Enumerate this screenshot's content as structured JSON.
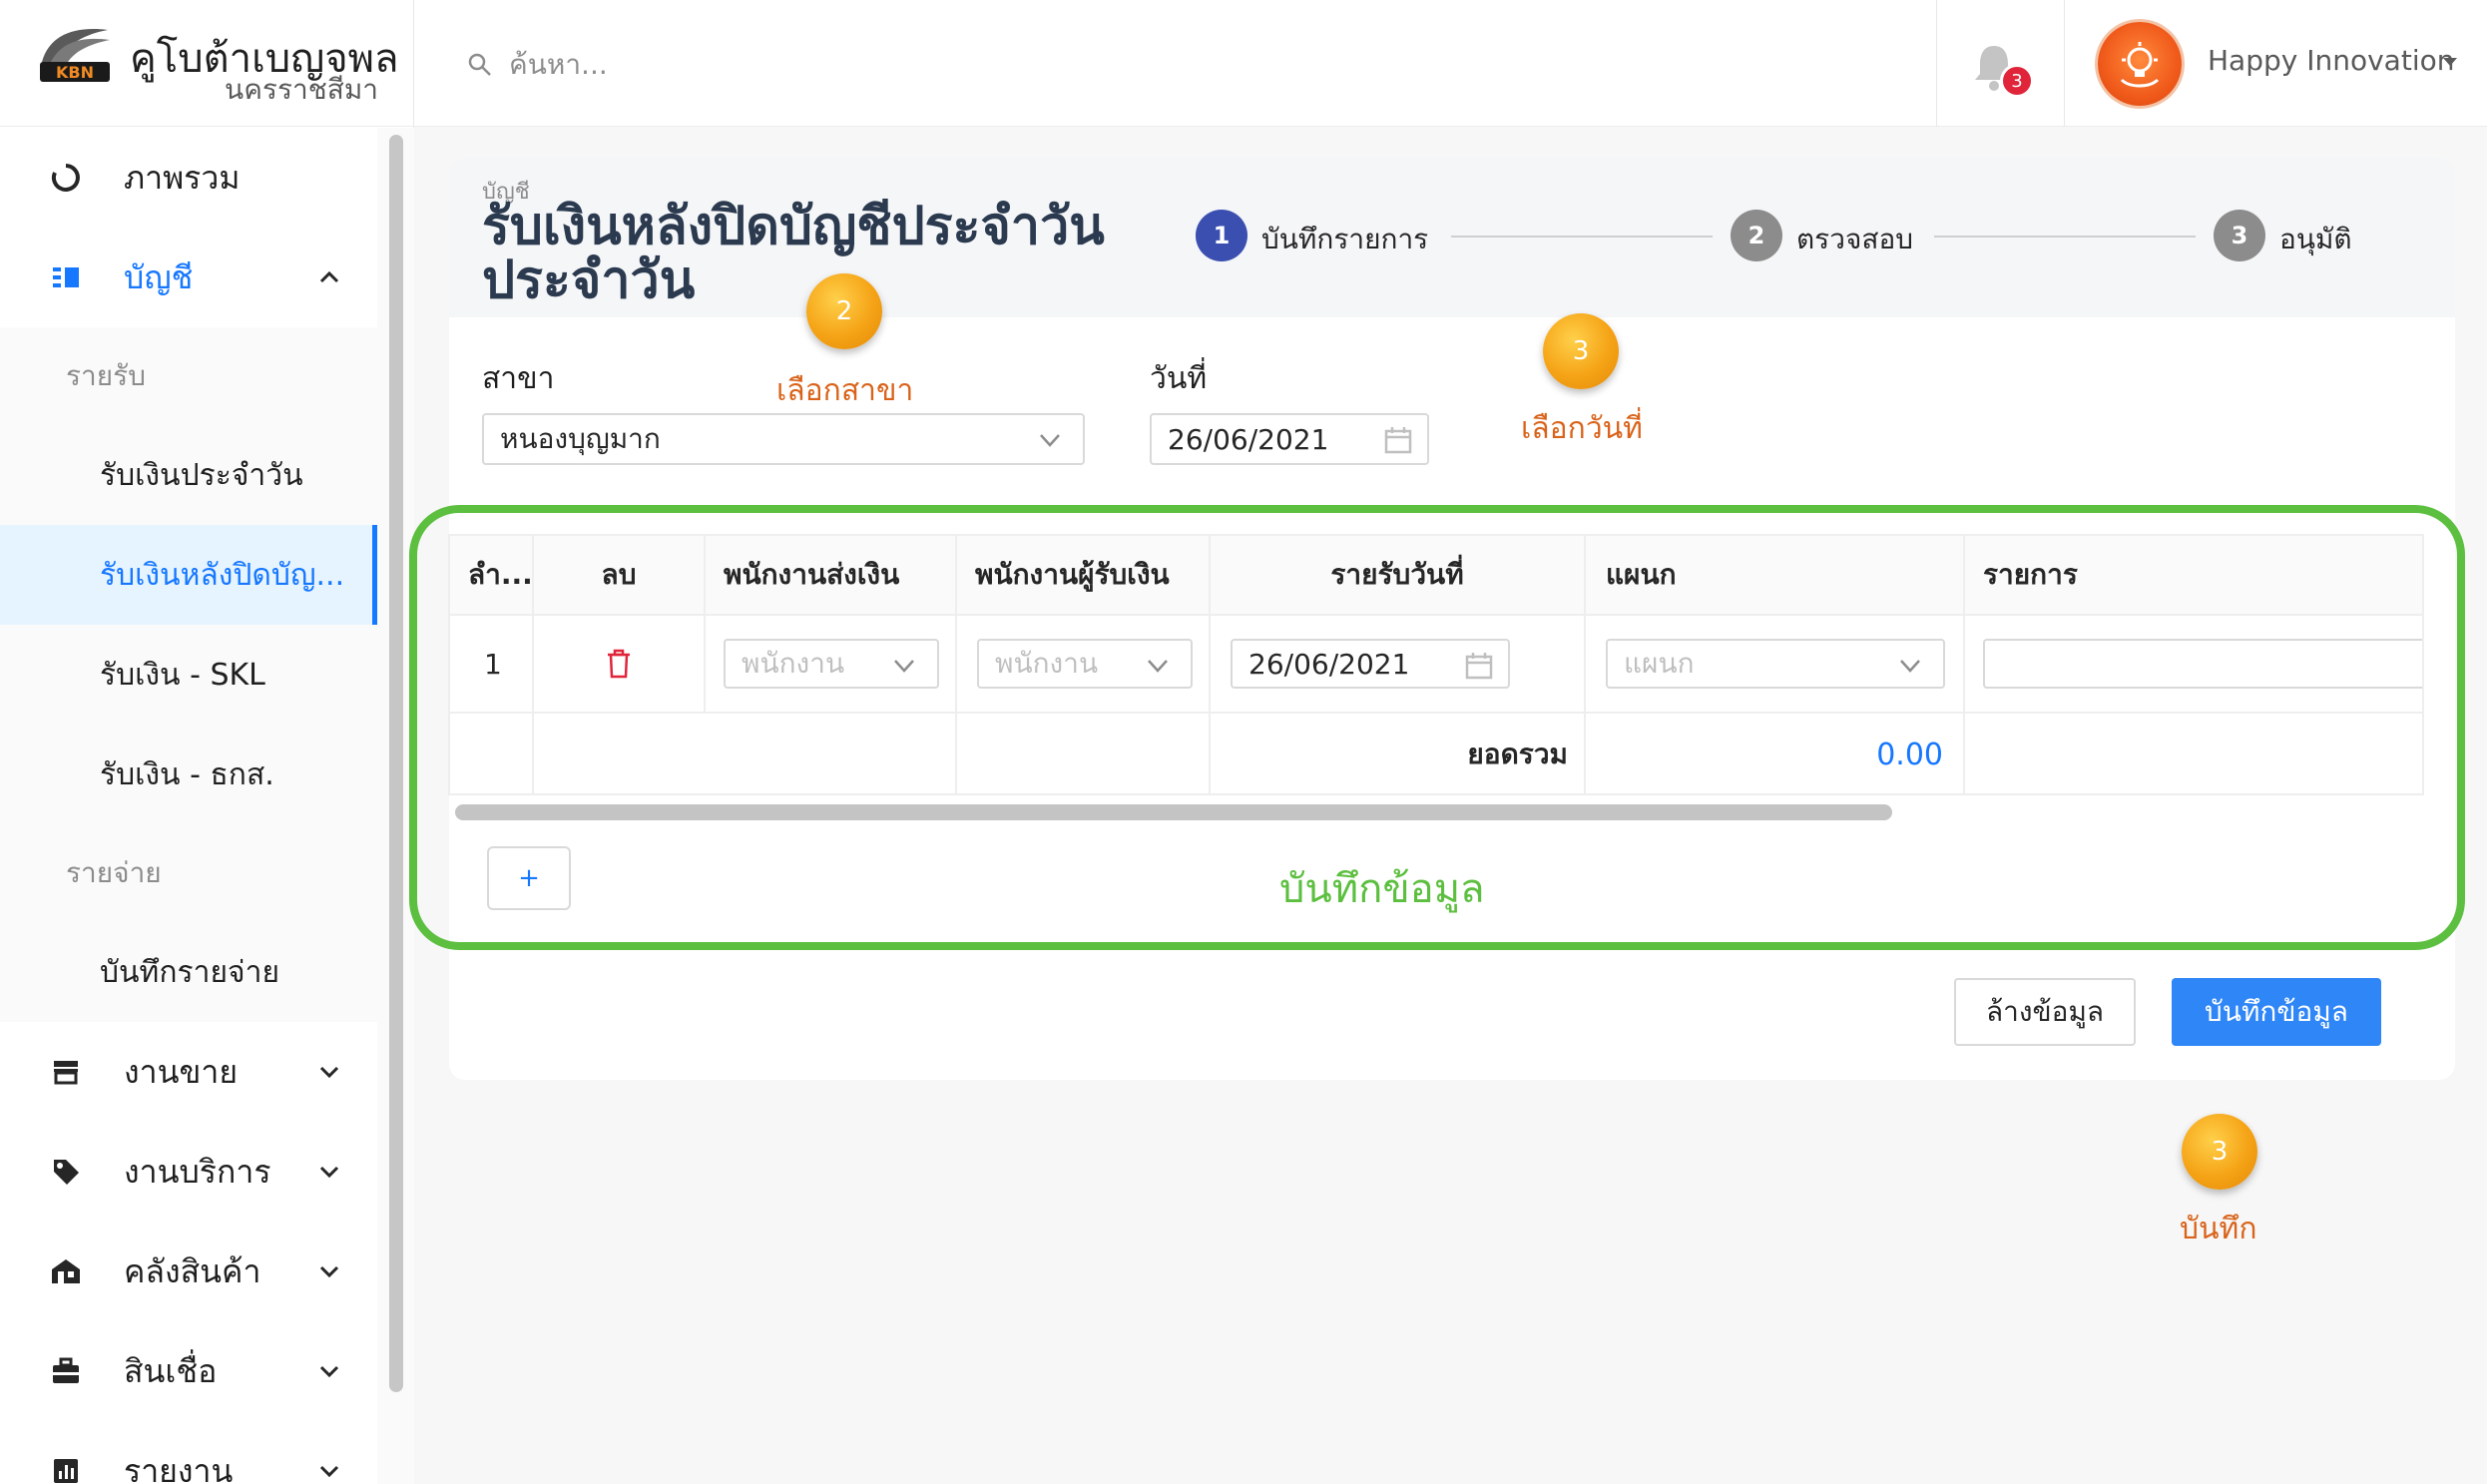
{
  "brand": {
    "title": "คูโบต้าเบญจพล",
    "subtitle": "นครราชสีมา",
    "logo_text": "KBN"
  },
  "header": {
    "search_placeholder": "ค้นหา...",
    "notification_count": "3",
    "user_name": "Happy Innovation"
  },
  "sidebar": {
    "overview": "ภาพรวม",
    "account": "บัญชี",
    "income_group": "รายรับ",
    "income_items": [
      "รับเงินประจำวัน",
      "รับเงินหลังปิดบัญ...",
      "รับเงิน - SKL",
      "รับเงิน - ธกส."
    ],
    "expense_group": "รายจ่าย",
    "expense_items": [
      "บันทึกรายจ่าย"
    ],
    "sales": "งานขาย",
    "service": "งานบริการ",
    "warehouse": "คลังสินค้า",
    "credit": "สินเชื่อ",
    "reports": "รายงาน"
  },
  "page": {
    "breadcrumb": "บัญชี",
    "title": "รับเงินหลังปิดบัญชีประจำวัน ประจำวัน"
  },
  "steps": [
    {
      "num": "1",
      "label": "บันทึกรายการ",
      "color": "#3a4fb0"
    },
    {
      "num": "2",
      "label": "ตรวจสอบ",
      "color": "#8c8c8c"
    },
    {
      "num": "3",
      "label": "อนุมัติ",
      "color": "#8c8c8c"
    }
  ],
  "form": {
    "branch_label": "สาขา",
    "branch_value": "หนองบุญมาก",
    "date_label": "วันที่",
    "date_value": "26/06/2021"
  },
  "annotations": {
    "branch": {
      "num": "2",
      "text": "เลือกสาขา"
    },
    "date": {
      "num": "3",
      "text": "เลือกวันที่"
    },
    "save": {
      "num": "3",
      "text": "บันทึก"
    },
    "table_caption": "บันทึกข้อมูล"
  },
  "table": {
    "headers": [
      "ลำ...",
      "ลบ",
      "พนักงานส่งเงิน",
      "พนักงานผู้รับเงิน",
      "รายรับวันที่",
      "แผนก",
      "รายการ"
    ],
    "row": {
      "index": "1",
      "sender_placeholder": "พนักงาน",
      "receiver_placeholder": "พนักงาน",
      "date": "26/06/2021",
      "department_placeholder": "แผนก"
    },
    "total_label": "ยอดรวม",
    "total_value": "0.00",
    "add_label": "+"
  },
  "actions": {
    "clear": "ล้างข้อมูล",
    "save": "บันทึกข้อมูล"
  },
  "colors": {
    "accent": "#1677ff",
    "highlight_frame": "#5cbf3f",
    "annotation": "#f5a316"
  }
}
